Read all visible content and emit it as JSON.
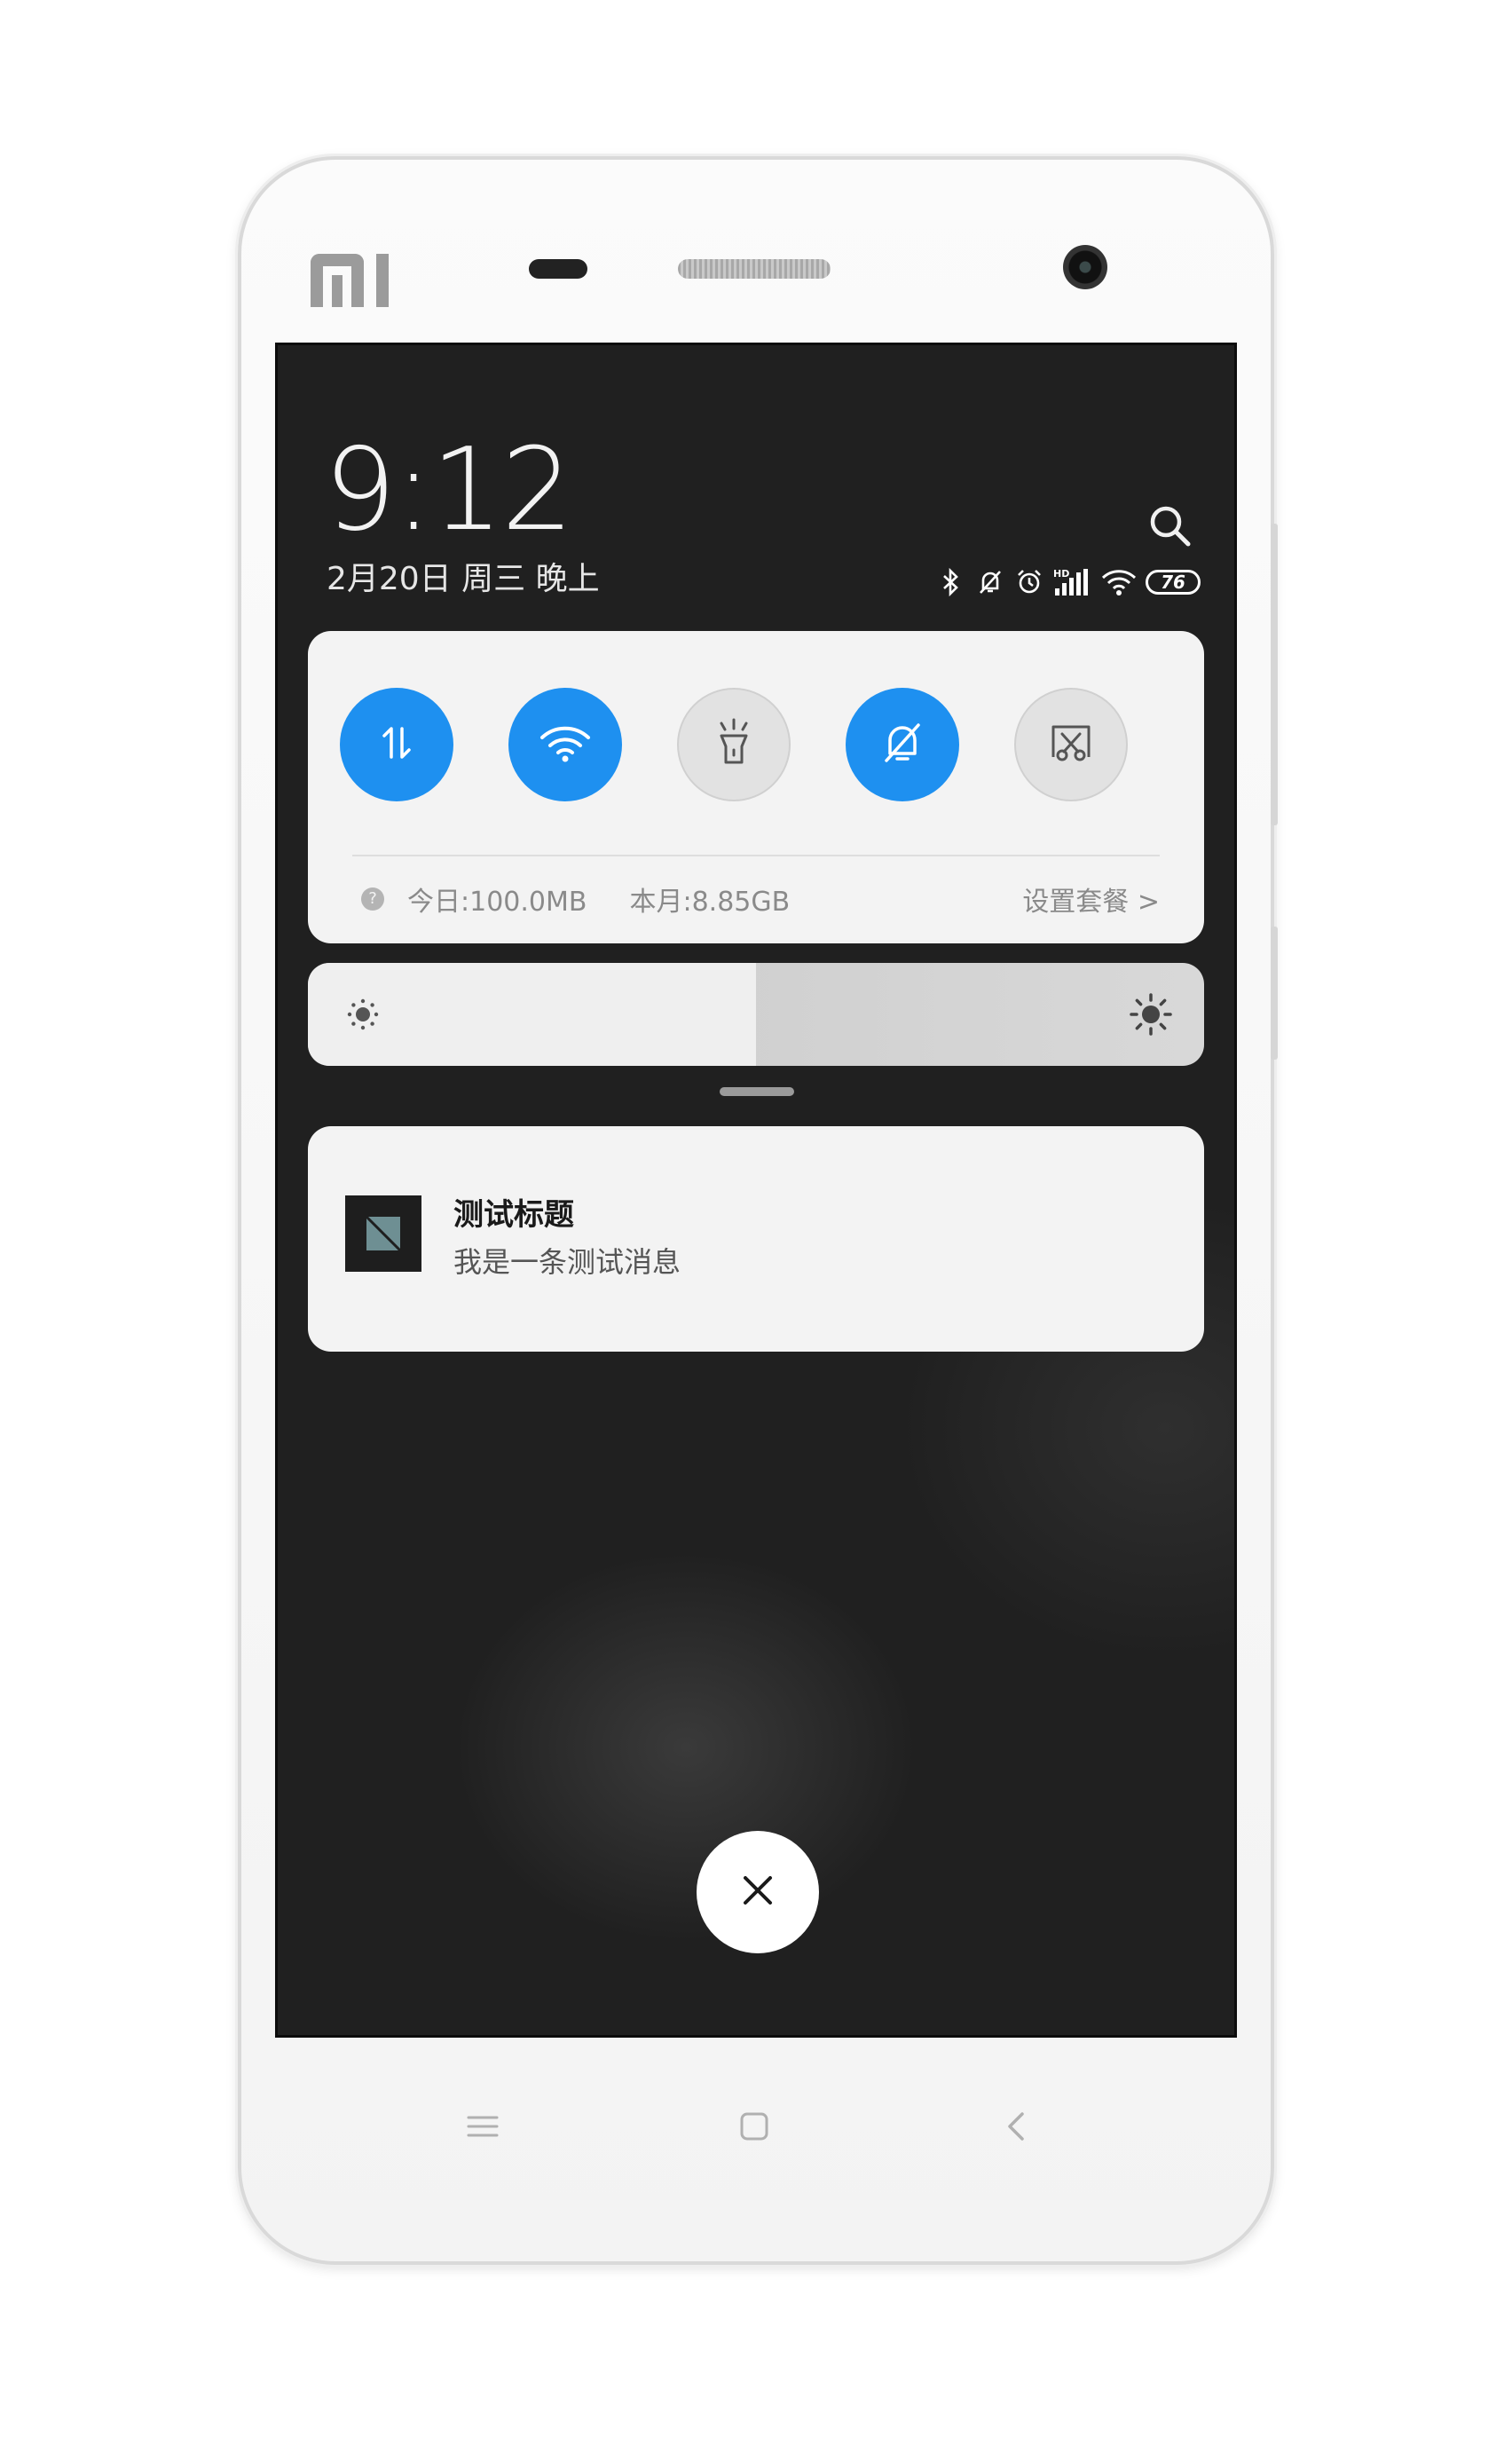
{
  "status_bar": {
    "time": "9:12",
    "date": "2月20日 周三 晚上",
    "battery_level": "76",
    "signal_label": "HD"
  },
  "quick_settings": {
    "tiles": [
      {
        "name": "mobile-data",
        "icon": "data-arrows-icon",
        "active": true
      },
      {
        "name": "wifi",
        "icon": "wifi-icon",
        "active": true
      },
      {
        "name": "flashlight",
        "icon": "flashlight-icon",
        "active": false
      },
      {
        "name": "silent",
        "icon": "bell-off-icon",
        "active": true
      },
      {
        "name": "screenshot",
        "icon": "screenshot-scissors-icon",
        "active": false
      }
    ],
    "data_today": "今日:100.0MB",
    "data_month": "本月:8.85GB",
    "plan_link": "设置套餐 >"
  },
  "brightness": {
    "level": 0.5
  },
  "notification": {
    "title": "测试标题",
    "text": "我是一条测试消息"
  },
  "colors": {
    "accent": "#1e90f0",
    "screen_bg": "#202020",
    "panel_bg": "#f3f3f3"
  }
}
